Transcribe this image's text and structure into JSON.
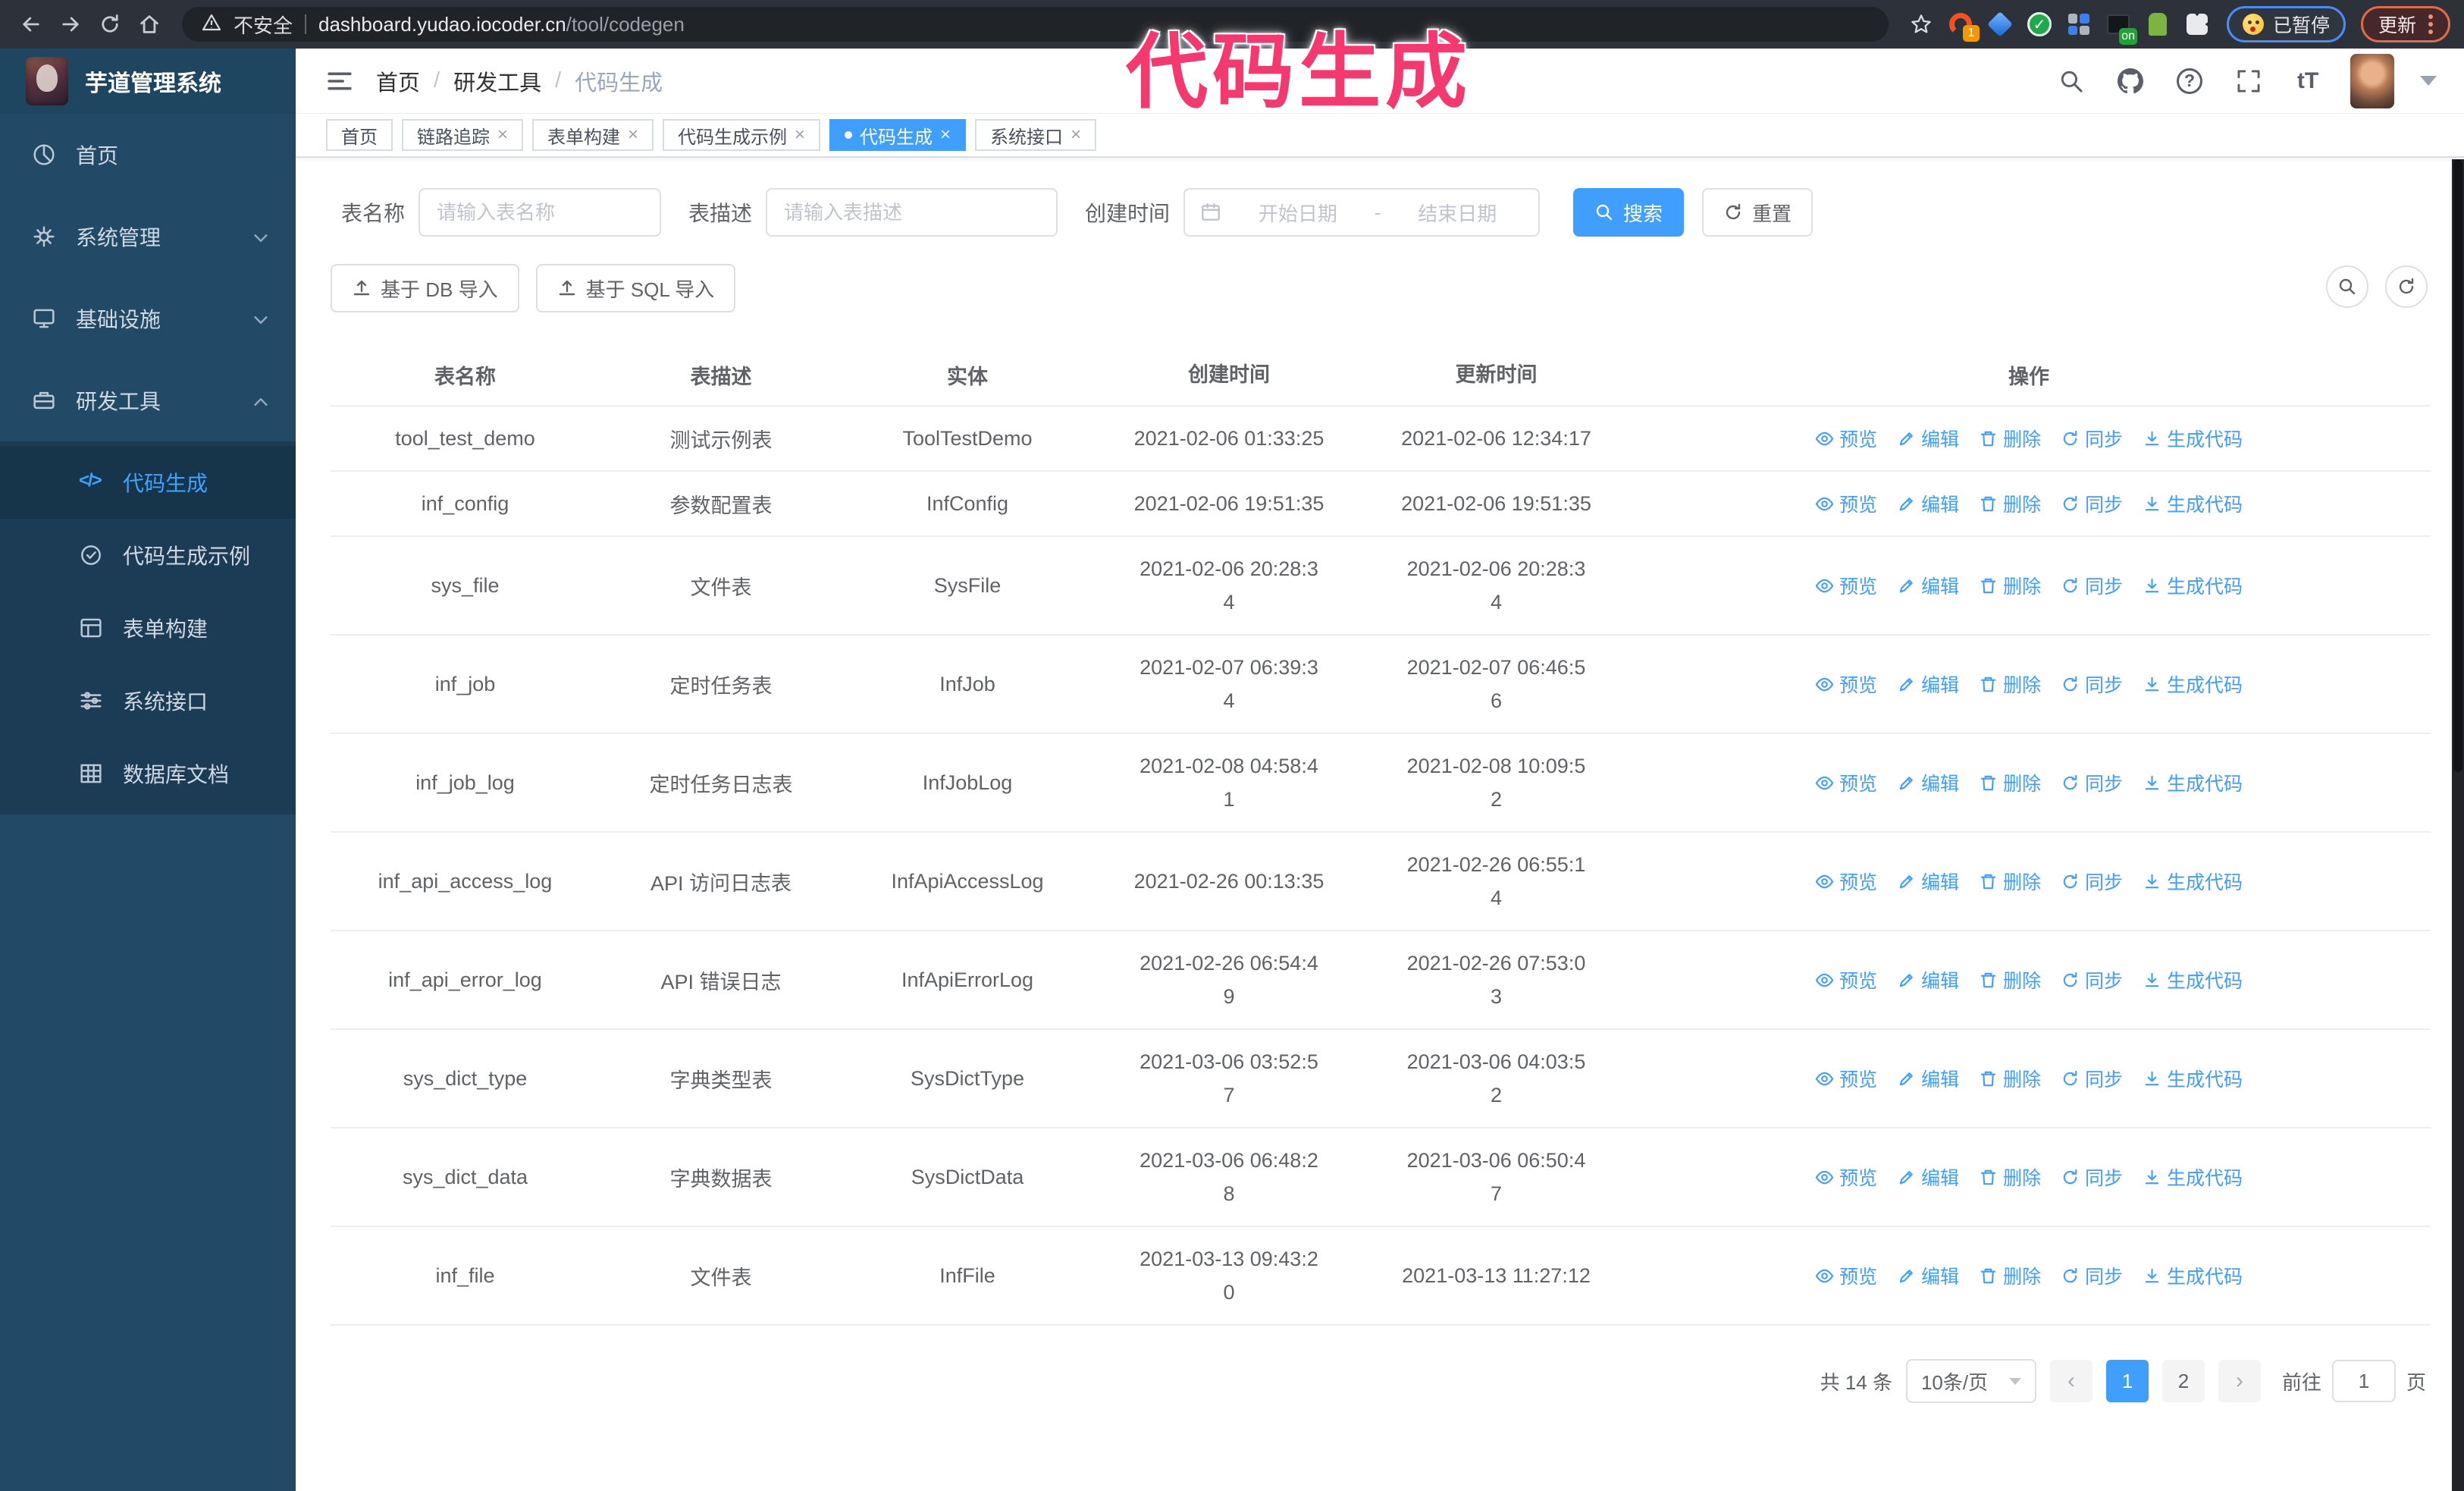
{
  "browser": {
    "security_label": "不安全",
    "url_host": "dashboard.yudao.iocoder.cn",
    "url_path": "/tool/codegen",
    "ext_badge": "1",
    "ext_on": "on",
    "paused_badge": "已暂停",
    "update_button": "更新"
  },
  "annotation": {
    "text": "代码生成",
    "color": "#f5386f"
  },
  "sidebar": {
    "title": "芋道管理系统",
    "items": [
      {
        "label": "首页"
      },
      {
        "label": "系统管理"
      },
      {
        "label": "基础设施"
      },
      {
        "label": "研发工具"
      }
    ],
    "sub_items": [
      {
        "label": "代码生成",
        "active": true
      },
      {
        "label": "代码生成示例"
      },
      {
        "label": "表单构建"
      },
      {
        "label": "系统接口"
      },
      {
        "label": "数据库文档"
      }
    ]
  },
  "breadcrumb": {
    "separator": "/",
    "items": [
      "首页",
      "研发工具",
      "代码生成"
    ]
  },
  "header": {
    "font_icon": "tT"
  },
  "tabs": {
    "items": [
      {
        "label": "首页",
        "closable": false,
        "active": false
      },
      {
        "label": "链路追踪",
        "closable": true,
        "active": false
      },
      {
        "label": "表单构建",
        "closable": true,
        "active": false
      },
      {
        "label": "代码生成示例",
        "closable": true,
        "active": false
      },
      {
        "label": "代码生成",
        "closable": true,
        "active": true
      },
      {
        "label": "系统接口",
        "closable": true,
        "active": false
      }
    ]
  },
  "search": {
    "name_label": "表名称",
    "name_placeholder": "请输入表名称",
    "desc_label": "表描述",
    "desc_placeholder": "请输入表描述",
    "time_label": "创建时间",
    "start_placeholder": "开始日期",
    "range_separator": "-",
    "end_placeholder": "结束日期",
    "search_button": "搜索",
    "reset_button": "重置"
  },
  "toolbar": {
    "import_db": "基于 DB 导入",
    "import_sql": "基于 SQL 导入"
  },
  "table": {
    "columns": [
      "表名称",
      "表描述",
      "实体",
      "创建时间",
      "更新时间",
      "操作"
    ],
    "actions": [
      "预览",
      "编辑",
      "删除",
      "同步",
      "生成代码"
    ],
    "rows": [
      {
        "name": "tool_test_demo",
        "desc": "测试示例表",
        "entity": "ToolTestDemo",
        "created": "2021-02-06 01:33:25",
        "updated": "2021-02-06 12:34:17"
      },
      {
        "name": "inf_config",
        "desc": "参数配置表",
        "entity": "InfConfig",
        "created": "2021-02-06 19:51:35",
        "updated": "2021-02-06 19:51:35"
      },
      {
        "name": "sys_file",
        "desc": "文件表",
        "entity": "SysFile",
        "created": "2021-02-06 20:28:3\n4",
        "updated": "2021-02-06 20:28:3\n4"
      },
      {
        "name": "inf_job",
        "desc": "定时任务表",
        "entity": "InfJob",
        "created": "2021-02-07 06:39:3\n4",
        "updated": "2021-02-07 06:46:5\n6"
      },
      {
        "name": "inf_job_log",
        "desc": "定时任务日志表",
        "entity": "InfJobLog",
        "created": "2021-02-08 04:58:4\n1",
        "updated": "2021-02-08 10:09:5\n2"
      },
      {
        "name": "inf_api_access_log",
        "desc": "API 访问日志表",
        "entity": "InfApiAccessLog",
        "created": "2021-02-26 00:13:35",
        "updated": "2021-02-26 06:55:1\n4"
      },
      {
        "name": "inf_api_error_log",
        "desc": "API 错误日志",
        "entity": "InfApiErrorLog",
        "created": "2021-02-26 06:54:4\n9",
        "updated": "2021-02-26 07:53:0\n3"
      },
      {
        "name": "sys_dict_type",
        "desc": "字典类型表",
        "entity": "SysDictType",
        "created": "2021-03-06 03:52:5\n7",
        "updated": "2021-03-06 04:03:5\n2"
      },
      {
        "name": "sys_dict_data",
        "desc": "字典数据表",
        "entity": "SysDictData",
        "created": "2021-03-06 06:48:2\n8",
        "updated": "2021-03-06 06:50:4\n7"
      },
      {
        "name": "inf_file",
        "desc": "文件表",
        "entity": "InfFile",
        "created": "2021-03-13 09:43:2\n0",
        "updated": "2021-03-13 11:27:12"
      }
    ]
  },
  "pagination": {
    "total": "共 14 条",
    "page_size": "10条/页",
    "pages": [
      "1",
      "2"
    ],
    "active_page": "1",
    "goto_label": "前往",
    "goto_value": "1",
    "page_suffix": "页"
  }
}
